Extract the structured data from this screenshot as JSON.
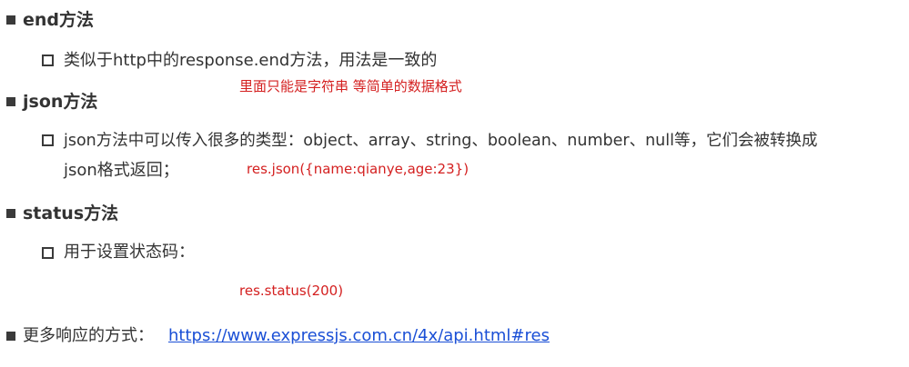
{
  "sections": [
    {
      "heading": "end方法",
      "items": [
        "类似于http中的response.end方法，用法是一致的"
      ],
      "note": "里面只能是字符串 等简单的数据格式"
    },
    {
      "heading": "json方法",
      "items": [
        "json方法中可以传入很多的类型：object、array、string、boolean、number、null等，它们会被转换成",
        "json格式返回；"
      ],
      "note": "res.json({name:qianye,age:23})"
    },
    {
      "heading": "status方法",
      "items": [
        "用于设置状态码："
      ],
      "note": "res.status(200)"
    }
  ],
  "footer": {
    "label": "更多响应的方式：",
    "link_text": "https://www.expressjs.com.cn/4x/api.html#res"
  },
  "colors": {
    "text": "#333333",
    "note": "#d42020",
    "link": "#1a4fd6"
  },
  "icons": {
    "section_bullet": "filled-square-icon",
    "item_bullet": "hollow-square-icon"
  }
}
